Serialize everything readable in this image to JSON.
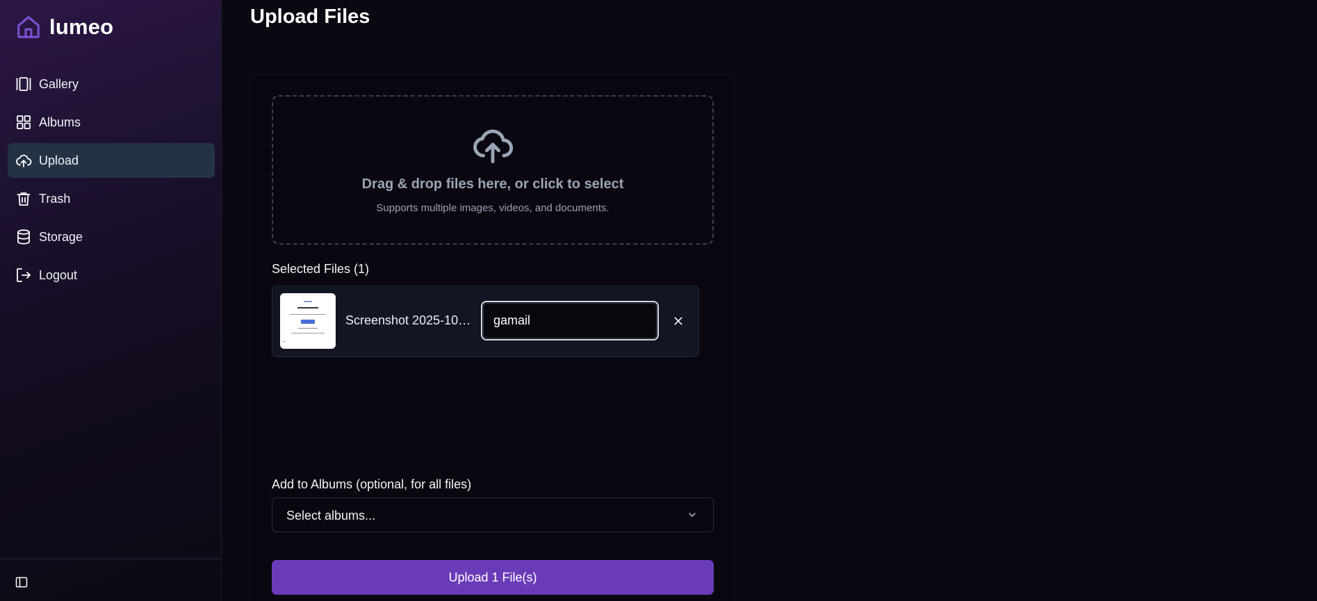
{
  "app": {
    "name": "lumeo",
    "logo_icon": "home-icon"
  },
  "colors": {
    "accent": "#6a3bb8",
    "active_nav_bg": "#243246",
    "logo": "#7a4fd0"
  },
  "sidebar": {
    "items": [
      {
        "label": "Gallery",
        "icon": "gallery-icon",
        "active": false
      },
      {
        "label": "Albums",
        "icon": "grid-icon",
        "active": false
      },
      {
        "label": "Upload",
        "icon": "cloud-upload-icon",
        "active": true
      },
      {
        "label": "Trash",
        "icon": "trash-icon",
        "active": false
      },
      {
        "label": "Storage",
        "icon": "database-icon",
        "active": false
      },
      {
        "label": "Logout",
        "icon": "logout-icon",
        "active": false
      }
    ],
    "footer_icon": "sidebar-toggle-icon"
  },
  "main": {
    "title": "Upload Files",
    "dropzone": {
      "title": "Drag & drop files here, or click to select",
      "subtitle": "Supports multiple images, videos, and documents."
    },
    "selected_files": {
      "label": "Selected Files (1)",
      "files": [
        {
          "name": "Screenshot 2025-10-…",
          "rename_value": "gamail"
        }
      ]
    },
    "albums": {
      "label": "Add to Albums (optional, for all files)",
      "placeholder": "Select albums..."
    },
    "upload_button": "Upload 1 File(s)"
  }
}
